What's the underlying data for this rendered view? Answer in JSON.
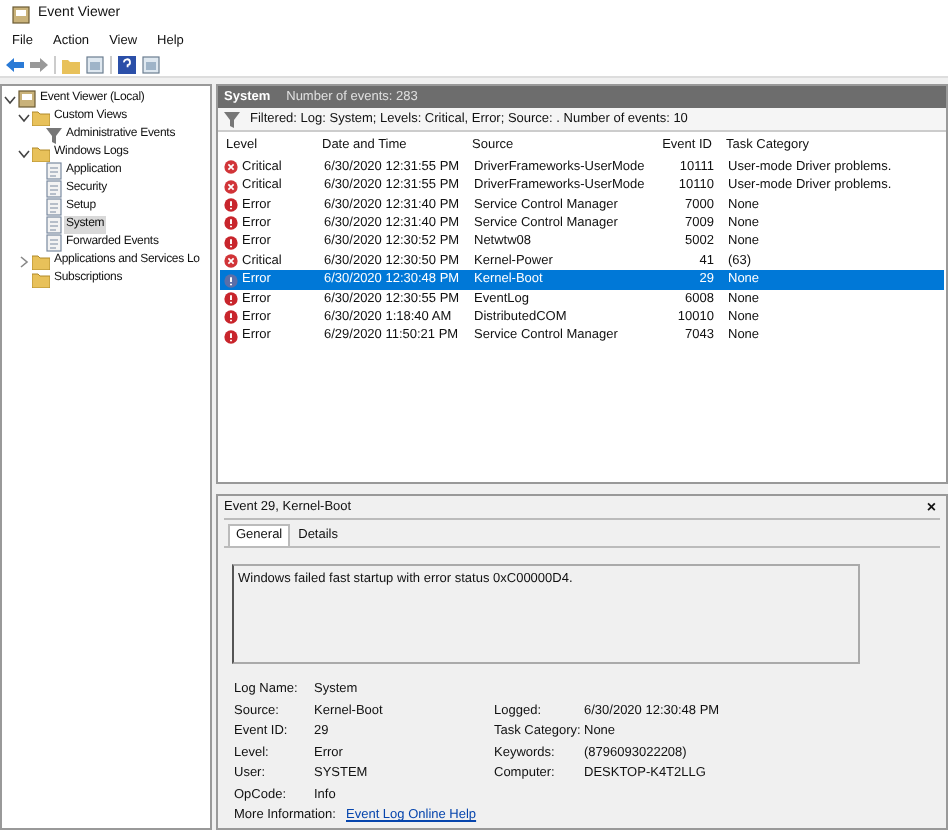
{
  "window": {
    "title": "Event Viewer"
  },
  "menu": [
    "File",
    "Action",
    "View",
    "Help"
  ],
  "tree": [
    {
      "label": "Event Viewer (Local)",
      "kind": "viewer",
      "selected": false,
      "expanded": true,
      "children": [
        {
          "label": "Custom Views",
          "kind": "folder",
          "selected": false,
          "expanded": true,
          "children": [
            {
              "label": "Administrative Events",
              "kind": "filter",
              "selected": false
            }
          ]
        },
        {
          "label": "Windows Logs",
          "kind": "folder",
          "selected": false,
          "expanded": true,
          "children": [
            {
              "label": "Application",
              "kind": "log",
              "selected": false
            },
            {
              "label": "Security",
              "kind": "log",
              "selected": false
            },
            {
              "label": "Setup",
              "kind": "log",
              "selected": false
            },
            {
              "label": "System",
              "kind": "log",
              "selected": true
            },
            {
              "label": "Forwarded Events",
              "kind": "log",
              "selected": false
            }
          ]
        },
        {
          "label": "Applications and Services Lo",
          "kind": "folder",
          "selected": false,
          "expanded": false
        },
        {
          "label": "Subscriptions",
          "kind": "folder",
          "selected": false
        }
      ]
    }
  ],
  "log_header": {
    "name": "System",
    "count": "Number of events: 283"
  },
  "filter": "Filtered: Log: System; Levels: Critical, Error; Source: . Number of events: 10",
  "table": {
    "columns": [
      "Level",
      "Date and Time",
      "Source",
      "Event ID",
      "Task Category"
    ],
    "rows": [
      {
        "kind": "critical",
        "level": "Critical",
        "date": "6/30/2020 12:31:55 PM",
        "source": "DriverFrameworks-UserMode",
        "id": "10111",
        "category": "User-mode Driver problems.",
        "selected": false
      },
      {
        "kind": "critical",
        "level": "Critical",
        "date": "6/30/2020 12:31:55 PM",
        "source": "DriverFrameworks-UserMode",
        "id": "10110",
        "category": "User-mode Driver problems.",
        "selected": false
      },
      {
        "kind": "error",
        "level": "Error",
        "date": "6/30/2020 12:31:40 PM",
        "source": "Service Control Manager",
        "id": "7000",
        "category": "None",
        "selected": false
      },
      {
        "kind": "error",
        "level": "Error",
        "date": "6/30/2020 12:31:40 PM",
        "source": "Service Control Manager",
        "id": "7009",
        "category": "None",
        "selected": false
      },
      {
        "kind": "error",
        "level": "Error",
        "date": "6/30/2020 12:30:52 PM",
        "source": "Netwtw08",
        "id": "5002",
        "category": "None",
        "selected": false
      },
      {
        "kind": "critical",
        "level": "Critical",
        "date": "6/30/2020 12:30:50 PM",
        "source": "Kernel-Power",
        "id": "41",
        "category": "(63)",
        "selected": false
      },
      {
        "kind": "error",
        "level": "Error",
        "date": "6/30/2020 12:30:48 PM",
        "source": "Kernel-Boot",
        "id": "29",
        "category": "None",
        "selected": true
      },
      {
        "kind": "error",
        "level": "Error",
        "date": "6/30/2020 12:30:55 PM",
        "source": "EventLog",
        "id": "6008",
        "category": "None",
        "selected": false
      },
      {
        "kind": "error",
        "level": "Error",
        "date": "6/30/2020 1:18:40 AM",
        "source": "DistributedCOM",
        "id": "10010",
        "category": "None",
        "selected": false
      },
      {
        "kind": "error",
        "level": "Error",
        "date": "6/29/2020 11:50:21 PM",
        "source": "Service Control Manager",
        "id": "7043",
        "category": "None",
        "selected": false
      }
    ]
  },
  "detail": {
    "title": "Event 29, Kernel-Boot",
    "close": "×",
    "tabs": [
      {
        "label": "General",
        "selected": true
      },
      {
        "label": "Details",
        "selected": false
      }
    ],
    "message": "Windows failed fast startup with error status 0xC00000D4.",
    "left": [
      {
        "label": "Log Name:",
        "value": "System"
      },
      {
        "label": "Source:",
        "value": "Kernel-Boot"
      },
      {
        "label": "Event ID:",
        "value": "29"
      },
      {
        "label": "Level:",
        "value": "Error"
      },
      {
        "label": "User:",
        "value": "SYSTEM"
      },
      {
        "label": "OpCode:",
        "value": "Info"
      }
    ],
    "right": [
      {
        "label": "Logged:",
        "value": "6/30/2020 12:30:48 PM"
      },
      {
        "label": "Task Category:",
        "value": "None"
      },
      {
        "label": "Keywords:",
        "value": "(8796093022208)"
      },
      {
        "label": "Computer:",
        "value": "DESKTOP-K4T2LLG"
      }
    ],
    "more": {
      "label": "More Information:",
      "link": "Event Log Online Help"
    }
  }
}
